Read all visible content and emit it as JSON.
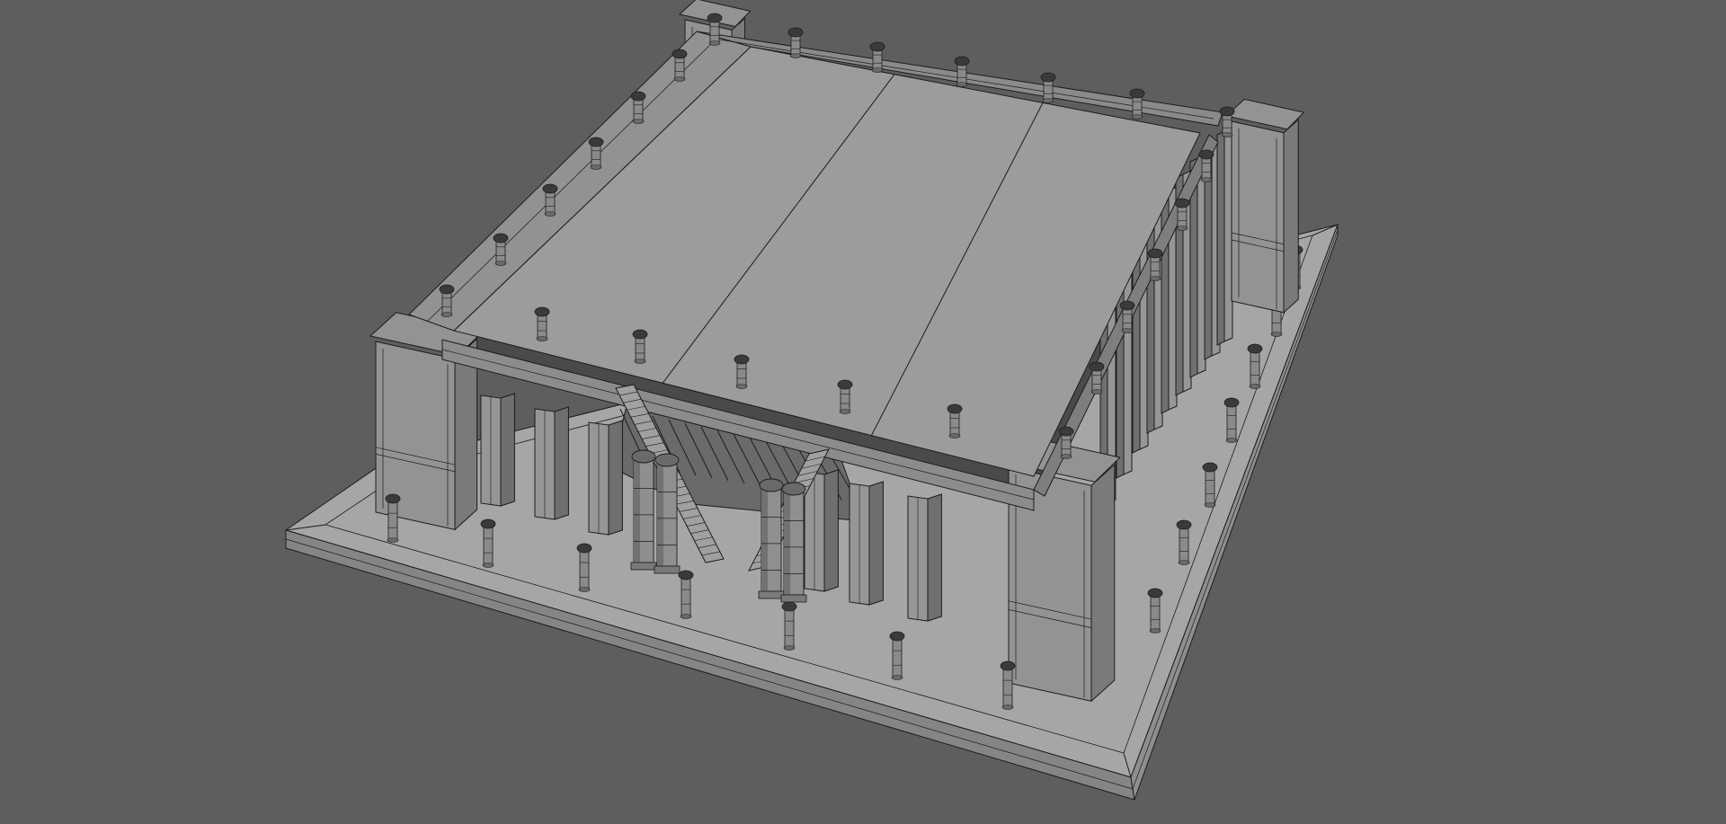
{
  "viewport": {
    "background": "#5e5e5e",
    "render_mode": "wireframe-on-shaded",
    "subject": "building-model"
  },
  "colors": {
    "wire": "#1c1c1c",
    "roof": "#9c9c9c",
    "plinth_top": "#a6a6a6",
    "plinth_side": "#8e8e8e",
    "plinth_front": "#858585",
    "tower": "#939393",
    "tower_shade": "#7a7a7a",
    "pillar": "#969696",
    "pillar_shade": "#6f6f6f",
    "interior": "#4a4a4a",
    "post": "#8a8a8a",
    "post_cap": "#3a3a3a"
  },
  "model": {
    "roof_panels": 3,
    "roof_posts": 32,
    "ground_posts": 16,
    "towers": 4,
    "front_pillars": 8,
    "right_pillars": 9,
    "entrance_columns": 4,
    "stairs": 2
  }
}
